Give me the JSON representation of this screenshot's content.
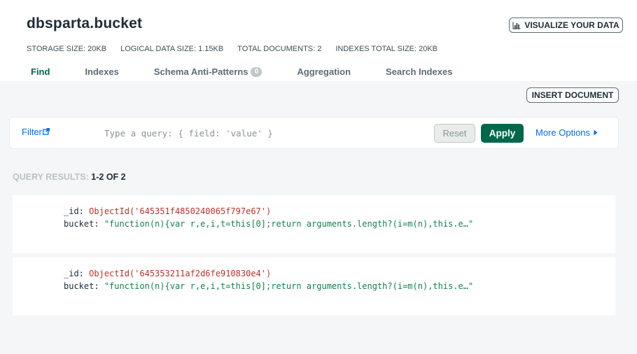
{
  "collection": {
    "title": "dbsparta.bucket",
    "visualize_label": "VISUALIZE YOUR DATA"
  },
  "stats": [
    {
      "label": "STORAGE SIZE:",
      "value": "20KB"
    },
    {
      "label": "LOGICAL DATA SIZE:",
      "value": "1.15KB"
    },
    {
      "label": "TOTAL DOCUMENTS:",
      "value": "2"
    },
    {
      "label": "INDEXES TOTAL SIZE:",
      "value": "20KB"
    }
  ],
  "tabs": [
    {
      "label": "Find",
      "active": true
    },
    {
      "label": "Indexes"
    },
    {
      "label": "Schema Anti-Patterns",
      "badge": "0"
    },
    {
      "label": "Aggregation"
    },
    {
      "label": "Search Indexes"
    }
  ],
  "toolbar": {
    "insert_label": "INSERT DOCUMENT"
  },
  "query": {
    "filter_label": "Filter",
    "placeholder": "Type a query: { field: 'value' }",
    "reset_label": "Reset",
    "apply_label": "Apply",
    "more_options_label": "More Options"
  },
  "results": {
    "label": "QUERY RESULTS:",
    "count": "1-2 OF 2"
  },
  "documents": [
    {
      "id_key": "_id:",
      "id_value": "ObjectId('645351f4850240065f797e67')",
      "bucket_key": "bucket:",
      "bucket_value": "\"function(n){var r,e,i,t=this[0];return arguments.length?(i=m(n),this.e…\""
    },
    {
      "id_key": "_id:",
      "id_value": "ObjectId('645353211af2d6fe910830e4')",
      "bucket_key": "bucket:",
      "bucket_value": "\"function(n){var r,e,i,t=this[0];return arguments.length?(i=m(n),this.e…\""
    }
  ],
  "colors": {
    "accent_green": "#00684a",
    "link_blue": "#016bf8",
    "objectid_red": "#c0312b",
    "string_green": "#12824d"
  },
  "icons": {
    "visualize": "bar-chart-icon",
    "filter": "external-link-icon",
    "more_options": "caret-right-icon"
  }
}
